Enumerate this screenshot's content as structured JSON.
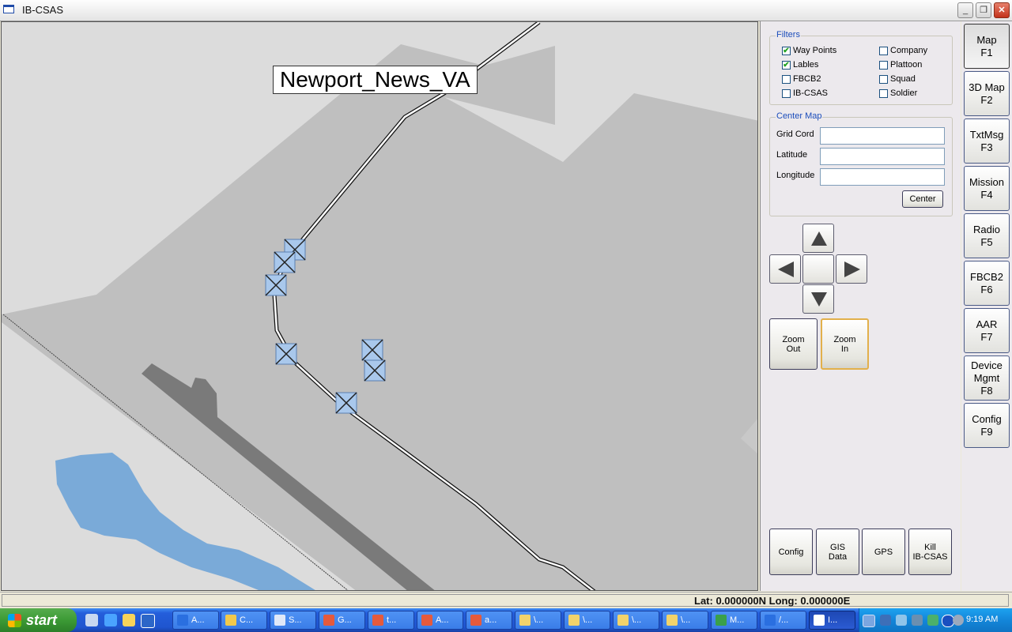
{
  "window": {
    "title": "IB-CSAS",
    "min_glyph": "_",
    "max_glyph": "❐",
    "close_glyph": "✕"
  },
  "map": {
    "location_label": "Newport_News_VA",
    "colors": {
      "land_light": "#dcdcdc",
      "land_mid": "#bfbfbf",
      "runway": "#7a7a7a",
      "water": "#7aaad8",
      "road": "#ffffff",
      "waypoint_fill": "#a9c8ec"
    }
  },
  "filters": {
    "legend": "Filters",
    "items": [
      {
        "label": "Way Points",
        "checked": true
      },
      {
        "label": "Lables",
        "checked": true
      },
      {
        "label": "FBCB2",
        "checked": false
      },
      {
        "label": "IB-CSAS",
        "checked": false
      },
      {
        "label": "Company",
        "checked": false
      },
      {
        "label": "Plattoon",
        "checked": false
      },
      {
        "label": "Squad",
        "checked": false
      },
      {
        "label": "Soldier",
        "checked": false
      }
    ],
    "check_glyph": "✔"
  },
  "center_map": {
    "legend": "Center Map",
    "grid_label": "Grid Cord",
    "grid_value": "",
    "lat_label": "Latitude",
    "lat_value": "",
    "long_label": "Longitude",
    "long_value": "",
    "center_button": "Center"
  },
  "zoom": {
    "out_line1": "Zoom",
    "out_line2": "Out",
    "in_line1": "Zoom",
    "in_line2": "In"
  },
  "bottom_buttons": {
    "config": "Config",
    "gis_line1": "GIS",
    "gis_line2": "Data",
    "gps": "GPS",
    "kill_line1": "Kill",
    "kill_line2": "IB-CSAS"
  },
  "function_keys": [
    {
      "line1": "Map",
      "line2": "F1",
      "line3": ""
    },
    {
      "line1": "3D Map",
      "line2": "F2",
      "line3": ""
    },
    {
      "line1": "TxtMsg",
      "line2": "F3",
      "line3": ""
    },
    {
      "line1": "Mission",
      "line2": "F4",
      "line3": ""
    },
    {
      "line1": "Radio",
      "line2": "F5",
      "line3": ""
    },
    {
      "line1": "FBCB2",
      "line2": "F6",
      "line3": ""
    },
    {
      "line1": "AAR",
      "line2": "F7",
      "line3": ""
    },
    {
      "line1": "Device",
      "line2": "Mgmt",
      "line3": "F8"
    },
    {
      "line1": "Config",
      "line2": "F9",
      "line3": ""
    }
  ],
  "status": {
    "coords": "Lat: 0.000000N  Long: 0.000000E"
  },
  "taskbar": {
    "start_label": "start",
    "tasks": [
      {
        "label": "A...",
        "icon_color": "#2a6fe0"
      },
      {
        "label": "C...",
        "icon_color": "#f2c94c"
      },
      {
        "label": "S...",
        "icon_color": "#e0e8f8"
      },
      {
        "label": "G...",
        "icon_color": "#e55a3c"
      },
      {
        "label": "t...",
        "icon_color": "#e55a3c"
      },
      {
        "label": "A...",
        "icon_color": "#e55a3c"
      },
      {
        "label": "a...",
        "icon_color": "#e55a3c"
      },
      {
        "label": "\\...",
        "icon_color": "#f2d36b"
      },
      {
        "label": "\\...",
        "icon_color": "#f2d36b"
      },
      {
        "label": "\\...",
        "icon_color": "#f2d36b"
      },
      {
        "label": "\\...",
        "icon_color": "#f2d36b"
      },
      {
        "label": "M...",
        "icon_color": "#3aa04a"
      },
      {
        "label": "/...",
        "icon_color": "#2a6fe0"
      },
      {
        "label": "I...",
        "icon_color": "#ffffff"
      }
    ],
    "clock": "9:19 AM"
  }
}
